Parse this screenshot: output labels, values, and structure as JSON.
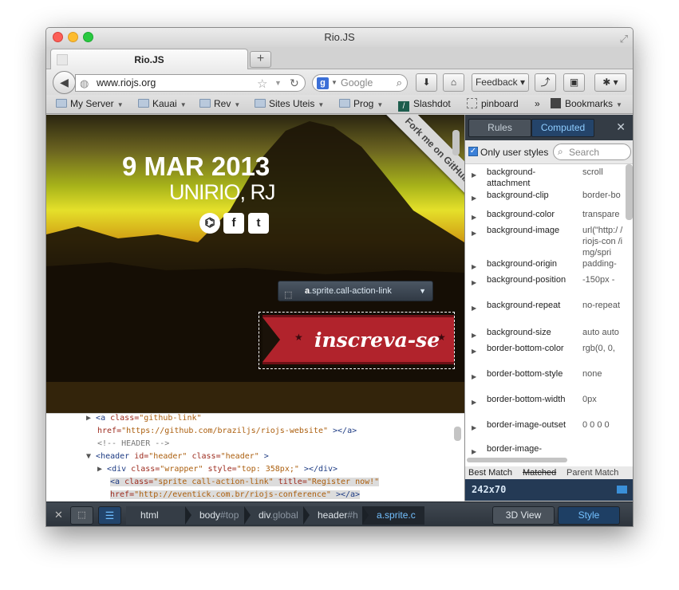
{
  "window": {
    "title": "Rio.JS"
  },
  "tab": {
    "label": "Rio.JS",
    "new_tab_label": "+"
  },
  "nav": {
    "back_glyph": "◀",
    "url": "www.riojs.org",
    "search_placeholder": "Google",
    "search_engine_letter": "g",
    "feedback_label": "Feedback ▾"
  },
  "bookmarks": {
    "items": [
      {
        "label": "My Server",
        "type": "folder"
      },
      {
        "label": "Kauai",
        "type": "folder"
      },
      {
        "label": "Rev",
        "type": "folder"
      },
      {
        "label": "Sites Uteis",
        "type": "folder"
      },
      {
        "label": "Prog",
        "type": "folder"
      },
      {
        "label": "Slashdot",
        "type": "link"
      },
      {
        "label": "pinboard",
        "type": "link"
      },
      {
        "label": "Bookmarks",
        "type": "folder"
      }
    ],
    "overflow_glyph": "»"
  },
  "page": {
    "date": "9 MAR 2013",
    "place": "UNIRIO, RJ",
    "social_icons": [
      "github-icon",
      "facebook-icon",
      "twitter-icon"
    ],
    "social_glyphs": [
      "⌬",
      "f",
      "t"
    ],
    "fork_ribbon": "Fork me on GitHub",
    "cta": "inscreva-se"
  },
  "inspector_label": {
    "tag": "a",
    "classes": ".sprite.call-action-link"
  },
  "markup": {
    "lines": [
      {
        "toggle": "▶",
        "parts": [
          [
            "tag",
            "<a "
          ],
          [
            "attr",
            "class="
          ],
          [
            "val",
            "\"github-link\""
          ]
        ]
      },
      {
        "toggle": "",
        "parts": [
          [
            "attr",
            "href="
          ],
          [
            "val",
            "\"https://github.com/braziljs/riojs-website\""
          ],
          [
            "tag",
            "  ></a>"
          ]
        ]
      },
      {
        "toggle": "",
        "parts": [
          [
            "cm",
            "<!-- HEADER -->"
          ]
        ]
      },
      {
        "toggle": "▼",
        "parts": [
          [
            "tag",
            "<header "
          ],
          [
            "attr",
            "id="
          ],
          [
            "val",
            "\"header\""
          ],
          [
            "attr",
            " class="
          ],
          [
            "val",
            "\"header\""
          ],
          [
            "tag",
            "  >"
          ]
        ]
      },
      {
        "toggle": "▶",
        "parts": [
          [
            "tag",
            "<div "
          ],
          [
            "attr",
            "class="
          ],
          [
            "val",
            "\"wrapper\""
          ],
          [
            "attr",
            " style="
          ],
          [
            "val",
            "\"top: 358px;\""
          ],
          [
            "tag",
            "  ></div>"
          ]
        ]
      },
      {
        "toggle": "",
        "parts": [
          [
            "tag",
            "<a "
          ],
          [
            "attr",
            "class="
          ],
          [
            "val",
            "\"sprite call-action-link\""
          ],
          [
            "attr",
            " title="
          ],
          [
            "val",
            "\"Register now!\""
          ]
        ]
      },
      {
        "toggle": "",
        "parts": [
          [
            "attr",
            "href="
          ],
          [
            "val",
            "\"http://eventick.com.br/riojs-conference\""
          ],
          [
            "tag",
            "  ></a>"
          ]
        ]
      }
    ]
  },
  "sidebar": {
    "tabs": [
      "Rules",
      "Computed"
    ],
    "active_tab": "Computed",
    "close_glyph": "✕",
    "only_user_styles_label": "Only user styles",
    "only_user_styles_checked": true,
    "search_placeholder": "Search",
    "properties": [
      {
        "name": "background-attachment",
        "value": "scroll"
      },
      {
        "name": "background-clip",
        "value": "border-bo"
      },
      {
        "name": "background-color",
        "value": "transpare"
      },
      {
        "name": "background-image",
        "value": "url(\"http:/ /riojs-con /img/spri"
      },
      {
        "name": "background-origin",
        "value": "padding-"
      },
      {
        "name": "background-position",
        "value": "-150px -"
      },
      {
        "name": "background-repeat",
        "value": "no-repeat"
      },
      {
        "name": "background-size",
        "value": "auto auto"
      },
      {
        "name": "border-bottom-color",
        "value": "rgb(0, 0,"
      },
      {
        "name": "border-bottom-style",
        "value": "none"
      },
      {
        "name": "border-bottom-width",
        "value": "0px"
      },
      {
        "name": "border-image-outset",
        "value": "0 0 0 0"
      },
      {
        "name": "border-image-",
        "value": ""
      }
    ],
    "footer": {
      "best_match": "Best Match",
      "matched": "Matched",
      "parent_match": "Parent Match"
    },
    "dimensions": "242x70"
  },
  "devtools": {
    "close_glyph": "✕",
    "breadcrumbs": [
      {
        "tag": "html",
        "suffix": ""
      },
      {
        "tag": "body",
        "suffix": "#top"
      },
      {
        "tag": "div",
        "suffix": ".global"
      },
      {
        "tag": "header",
        "suffix": "#h"
      },
      {
        "tag": "a",
        "suffix": ".sprite.c"
      }
    ],
    "view_3d_label": "3D View",
    "style_label": "Style"
  },
  "colors": {
    "accent_blue": "#73c0ff",
    "cta_red": "#b1232c",
    "toolbar_dark": "#343c45"
  }
}
